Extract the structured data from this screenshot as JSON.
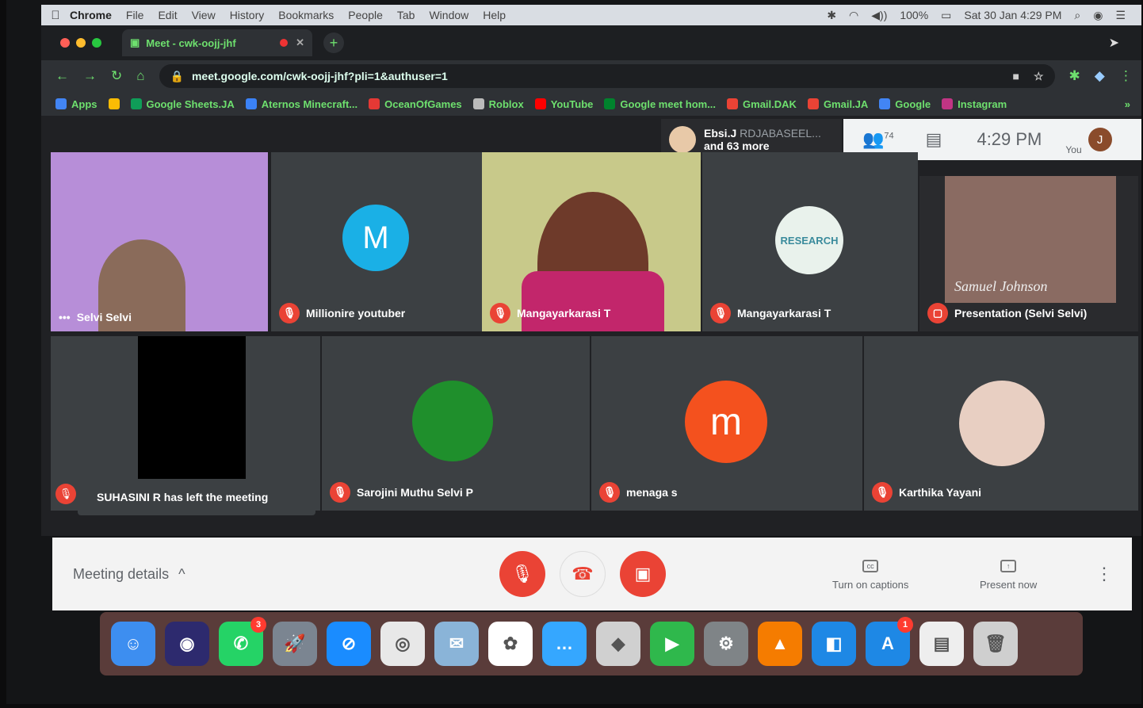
{
  "menubar": {
    "app": "Chrome",
    "items": [
      "File",
      "Edit",
      "View",
      "History",
      "Bookmarks",
      "People",
      "Tab",
      "Window",
      "Help"
    ],
    "battery": "100%",
    "datetime": "Sat 30 Jan 4:29 PM"
  },
  "browser": {
    "tab_title": "Meet - cwk-oojj-jhf",
    "url": "meet.google.com/cwk-oojj-jhf?pli=1&authuser=1",
    "bookmarks": [
      {
        "label": "Apps",
        "color": "#4285f4"
      },
      {
        "label": "",
        "color": "#fbbc04"
      },
      {
        "label": "Google Sheets.JA",
        "color": "#0f9d58"
      },
      {
        "label": "Aternos Minecraft...",
        "color": "#3b82f6"
      },
      {
        "label": "OceanOfGames",
        "color": "#e53935"
      },
      {
        "label": "Roblox",
        "color": "#bbbbbb"
      },
      {
        "label": "YouTube",
        "color": "#ff0000"
      },
      {
        "label": "Google meet hom...",
        "color": "#00832d"
      },
      {
        "label": "Gmail.DAK",
        "color": "#ea4335"
      },
      {
        "label": "Gmail.JA",
        "color": "#ea4335"
      },
      {
        "label": "Google",
        "color": "#4285f4"
      },
      {
        "label": "Instagram",
        "color": "#c13584"
      }
    ]
  },
  "meet": {
    "header": {
      "presenter_name": "Ebsi.J",
      "presenter_faded": "RDJABASEEL...",
      "more": "and 63 more",
      "participants_count": "74",
      "time": "4:29 PM",
      "you_label": "You",
      "avatar_initial": "J"
    },
    "tiles_row1": [
      {
        "name": "Selvi Selvi"
      },
      {
        "name": "Millionire youtuber",
        "initial": "M",
        "color": "#1ab0e6"
      },
      {
        "name": "Mangayarkarasi T"
      },
      {
        "name": "Mangayarkarasi T",
        "badge_text": "RESEARCH"
      },
      {
        "name": "Presentation (Selvi Selvi)",
        "slide_text": "Samuel Johnson"
      }
    ],
    "tiles_row2": [
      {
        "name": "Sarojini Muthu Selvi P"
      },
      {
        "name": "menaga s",
        "initial": "m",
        "color": "#f4511e"
      },
      {
        "name": "Karthika Yayani"
      }
    ],
    "toast": "SUHASINI R has left the meeting",
    "controls": {
      "meeting_details": "Meeting details",
      "captions": "Turn on captions",
      "present": "Present now"
    }
  },
  "dock": {
    "apps": [
      {
        "name": "finder",
        "color": "#3d8ef0",
        "glyph": "☺"
      },
      {
        "name": "siri",
        "color": "#2d2a6e",
        "glyph": "◉"
      },
      {
        "name": "whatsapp",
        "color": "#25d366",
        "glyph": "✆",
        "badge": "3"
      },
      {
        "name": "launchpad",
        "color": "#7b8591",
        "glyph": "🚀"
      },
      {
        "name": "safari",
        "color": "#1a8cff",
        "glyph": "⊘"
      },
      {
        "name": "chrome",
        "color": "#e8e8e8",
        "glyph": "◎"
      },
      {
        "name": "preview",
        "color": "#8ab4d8",
        "glyph": "✉"
      },
      {
        "name": "photos",
        "color": "#ffffff",
        "glyph": "✿"
      },
      {
        "name": "messages",
        "color": "#35a7ff",
        "glyph": "…"
      },
      {
        "name": "roblox",
        "color": "#d0d0d0",
        "glyph": "◆"
      },
      {
        "name": "facetime",
        "color": "#2fb84c",
        "glyph": "▶"
      },
      {
        "name": "system-preferences",
        "color": "#7f8487",
        "glyph": "⚙"
      },
      {
        "name": "vlc",
        "color": "#f57c00",
        "glyph": "▲"
      },
      {
        "name": "roblox-studio",
        "color": "#1e88e5",
        "glyph": "◧"
      },
      {
        "name": "app-store",
        "color": "#1e88e5",
        "glyph": "A",
        "badge": "1"
      },
      {
        "name": "document",
        "color": "#eeeeee",
        "glyph": "▤"
      },
      {
        "name": "trash",
        "color": "#cfcfcf",
        "glyph": "🗑"
      }
    ]
  }
}
